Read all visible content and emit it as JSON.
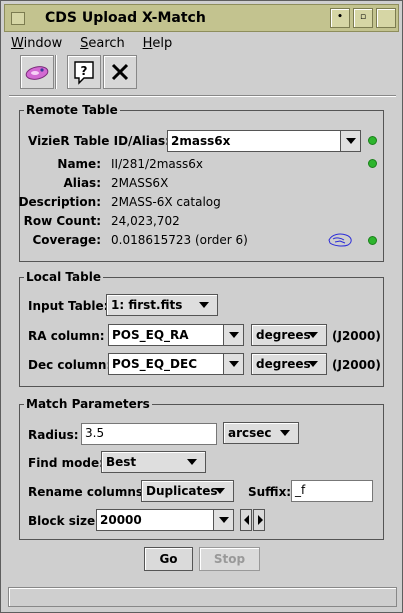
{
  "window": {
    "title": "CDS Upload X-Match"
  },
  "menu": [
    {
      "label": "Window"
    },
    {
      "label": "Search"
    },
    {
      "label": "Help"
    }
  ],
  "toolbar": {
    "icons": [
      "sky-match-icon",
      "help-icon",
      "close-icon"
    ],
    "help_glyph": "?"
  },
  "remote": {
    "legend": "Remote Table",
    "table_label": "VizieR Table ID/Alias:",
    "table_value": "2mass6x",
    "name_label": "Name:",
    "name_value": "II/281/2mass6x",
    "alias_label": "Alias:",
    "alias_value": "2MASS6X",
    "desc_label": "Description:",
    "desc_value": "2MASS-6X catalog",
    "rows_label": "Row Count:",
    "rows_value": "24,023,702",
    "coverage_label": "Coverage:",
    "coverage_value": "0.018615723 (order 6)",
    "status_color": "#2db52d"
  },
  "local": {
    "legend": "Local Table",
    "input_label": "Input Table:",
    "input_value": "1: first.fits",
    "ra_label": "RA column:",
    "ra_value": "POS_EQ_RA",
    "ra_unit": "degrees",
    "ra_epoch": "(J2000)",
    "dec_label": "Dec column:",
    "dec_value": "POS_EQ_DEC",
    "dec_unit": "degrees",
    "dec_epoch": "(J2000)"
  },
  "match": {
    "legend": "Match Parameters",
    "radius_label": "Radius:",
    "radius_value": "3.5",
    "radius_unit": "arcsec",
    "find_label": "Find mode:",
    "find_value": "Best",
    "rename_label": "Rename columns:",
    "rename_value": "Duplicates",
    "suffix_label": "Suffix:",
    "suffix_value": "_f",
    "block_label": "Block size:",
    "block_value": "20000"
  },
  "actions": {
    "go_label": "Go",
    "stop_label": "Stop"
  }
}
